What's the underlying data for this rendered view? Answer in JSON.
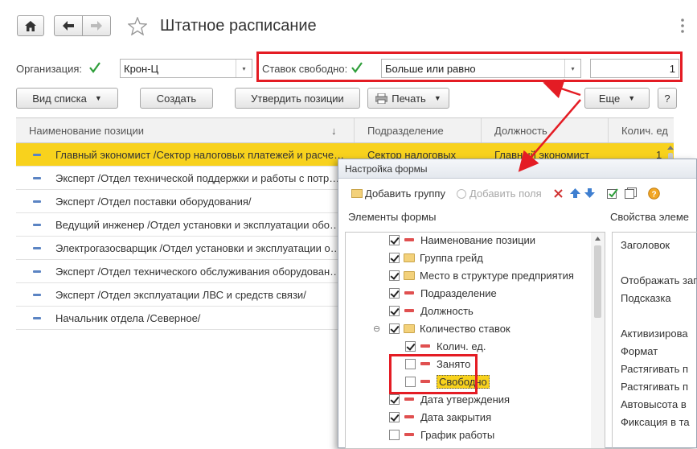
{
  "window": {
    "title": "Штатное расписание",
    "nav": {
      "home_icon": "home-icon",
      "back_icon": "arrow-left-icon",
      "forward_icon": "arrow-right-icon",
      "star_icon": "star-icon"
    }
  },
  "filters": {
    "org_label": "Организация:",
    "org_value": "Крон-Ц",
    "free_label": "Ставок свободно:",
    "condition_value": "Больше или равно",
    "number_value": "1"
  },
  "commands": {
    "view_list": "Вид списка",
    "create": "Создать",
    "approve": "Утвердить позиции",
    "print": "Печать",
    "more": "Еще",
    "help": "?"
  },
  "table": {
    "headers": [
      "Наименование позиции",
      "Подразделение",
      "Должность",
      "Колич. ед"
    ],
    "sort_arrow": "↓",
    "rows": [
      {
        "name": "Главный экономист /Сектор налоговых платежей и расче…",
        "dept": "Сектор налоговых",
        "pos": "Главный экономист",
        "qty": "1"
      },
      {
        "name": "Эксперт /Отдел технической поддержки и работы с потр…"
      },
      {
        "name": "Эксперт /Отдел поставки оборудования/"
      },
      {
        "name": "Ведущий инженер /Отдел установки и эксплуатации обо…"
      },
      {
        "name": "Электрогазосварщик /Отдел установки и эксплуатации о…"
      },
      {
        "name": "Эксперт /Отдел технического обслуживания оборудован…"
      },
      {
        "name": "Эксперт /Отдел эксплуатации ЛВС и средств связи/"
      },
      {
        "name": "Начальник отдела /Северное/"
      }
    ]
  },
  "dialog": {
    "title": "Настройка формы",
    "add_group": "Добавить группу",
    "add_fields": "Добавить поля",
    "elements_label": "Элементы формы",
    "props_label": "Свойства элеме",
    "tree": [
      {
        "label": "Наименование позиции",
        "checked": true,
        "icon": "field",
        "level": 1
      },
      {
        "label": "Группа грейд",
        "checked": true,
        "icon": "folder",
        "level": 1
      },
      {
        "label": "Место в структуре предприятия",
        "checked": true,
        "icon": "folder",
        "level": 1
      },
      {
        "label": "Подразделение",
        "checked": true,
        "icon": "field",
        "level": 1
      },
      {
        "label": "Должность",
        "checked": true,
        "icon": "field",
        "level": 1
      },
      {
        "label": "Количество ставок",
        "checked": true,
        "icon": "folder",
        "level": 1,
        "expander": "⊖"
      },
      {
        "label": "Колич. ед.",
        "checked": true,
        "icon": "field",
        "level": 2
      },
      {
        "label": "Занято",
        "checked": false,
        "icon": "field",
        "level": 2
      },
      {
        "label": "Свободно",
        "checked": false,
        "icon": "field",
        "level": 2,
        "highlight": true
      },
      {
        "label": "Дата утверждения",
        "checked": true,
        "icon": "field",
        "level": 1
      },
      {
        "label": "Дата закрытия",
        "checked": true,
        "icon": "field",
        "level": 1
      },
      {
        "label": "График работы",
        "checked": false,
        "icon": "field",
        "level": 1
      }
    ],
    "props": [
      "Заголовок",
      "Отображать заг",
      "Подсказка",
      "Активизирова",
      "Формат",
      "Растягивать п",
      "Растягивать п",
      "Автовысота в",
      "Фиксация в та"
    ]
  },
  "colors": {
    "highlight": "#f8d21d",
    "annotation": "#e41c24",
    "check": "#2e9e3a"
  }
}
